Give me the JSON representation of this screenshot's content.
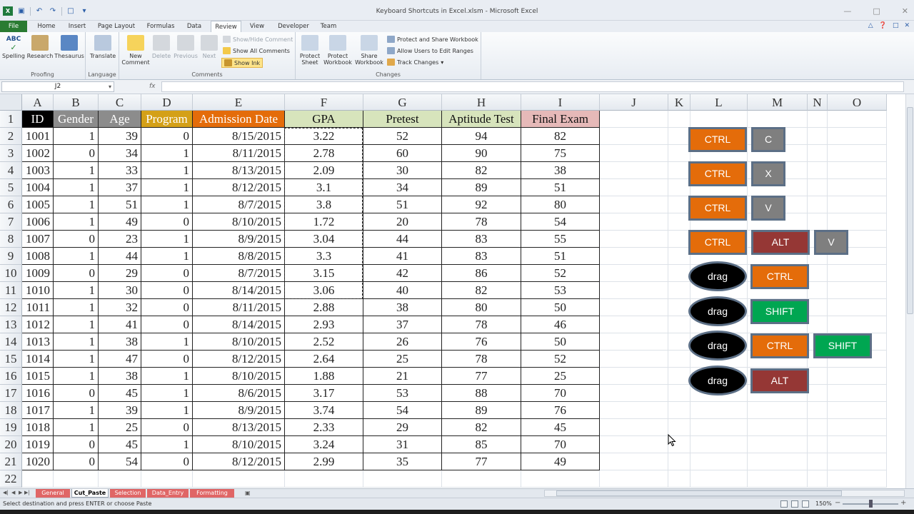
{
  "window": {
    "title": "Keyboard Shortcuts in Excel.xlsm  -  Microsoft Excel"
  },
  "menu_tabs": [
    "File",
    "Home",
    "Insert",
    "Page Layout",
    "Formulas",
    "Data",
    "Review",
    "View",
    "Developer",
    "Team"
  ],
  "active_tab": "Review",
  "ribbon": {
    "groups": {
      "proofing": "Proofing",
      "language": "Language",
      "comments": "Comments",
      "changes": "Changes"
    },
    "buttons": {
      "spelling": "Spelling",
      "research": "Research",
      "thesaurus": "Thesaurus",
      "translate": "Translate",
      "new_comment_1": "New",
      "new_comment_2": "Comment",
      "delete": "Delete",
      "previous": "Previous",
      "next": "Next",
      "show_hide_comment": "Show/Hide Comment",
      "show_all_comments": "Show All Comments",
      "show_ink": "Show Ink",
      "protect_sheet_1": "Protect",
      "protect_sheet_2": "Sheet",
      "protect_workbook_1": "Protect",
      "protect_workbook_2": "Workbook",
      "share_workbook_1": "Share",
      "share_workbook_2": "Workbook",
      "protect_share": "Protect and Share Workbook",
      "allow_users": "Allow Users to Edit Ranges",
      "track_changes": "Track Changes"
    },
    "spelling_glyph": "ABC"
  },
  "formula_bar": {
    "name_box": "J2",
    "fx": "fx",
    "value": ""
  },
  "columns": [
    "A",
    "B",
    "C",
    "D",
    "E",
    "F",
    "G",
    "H",
    "I",
    "J",
    "K",
    "L",
    "M",
    "N",
    "O"
  ],
  "rows": [
    "1",
    "2",
    "3",
    "4",
    "5",
    "6",
    "7",
    "8",
    "9",
    "10",
    "11",
    "12",
    "13",
    "14",
    "15",
    "16",
    "17",
    "18",
    "19",
    "20",
    "21",
    "22"
  ],
  "header_row": [
    "ID",
    "Gender",
    "Age",
    "Program",
    "Admission Date",
    "GPA",
    "Pretest",
    "Aptitude Test",
    "Final Exam"
  ],
  "header_colors": {
    "ID": "#000000",
    "Gender": "#8c8c8c",
    "Age": "#8c8c8c",
    "Program": "#d4a017",
    "Admission Date": "#e46c0a",
    "GPA": "#d7e4bc",
    "Pretest": "#d7e4bc",
    "Aptitude Test": "#d7e4bc",
    "Final Exam": "#e6b9b8"
  },
  "data_rows": [
    [
      "1001",
      "1",
      "39",
      "0",
      "8/15/2015",
      "3.22",
      "52",
      "94",
      "82"
    ],
    [
      "1002",
      "0",
      "34",
      "1",
      "8/11/2015",
      "2.78",
      "60",
      "90",
      "75"
    ],
    [
      "1003",
      "1",
      "33",
      "1",
      "8/13/2015",
      "2.09",
      "30",
      "82",
      "38"
    ],
    [
      "1004",
      "1",
      "37",
      "1",
      "8/12/2015",
      "3.1",
      "34",
      "89",
      "51"
    ],
    [
      "1005",
      "1",
      "51",
      "1",
      "8/7/2015",
      "3.8",
      "51",
      "92",
      "80"
    ],
    [
      "1006",
      "1",
      "49",
      "0",
      "8/10/2015",
      "1.72",
      "20",
      "78",
      "54"
    ],
    [
      "1007",
      "0",
      "23",
      "1",
      "8/9/2015",
      "3.04",
      "44",
      "83",
      "55"
    ],
    [
      "1008",
      "1",
      "44",
      "1",
      "8/8/2015",
      "3.3",
      "41",
      "83",
      "51"
    ],
    [
      "1009",
      "0",
      "29",
      "0",
      "8/7/2015",
      "3.15",
      "42",
      "86",
      "52"
    ],
    [
      "1010",
      "1",
      "30",
      "0",
      "8/14/2015",
      "3.06",
      "40",
      "82",
      "53"
    ],
    [
      "1011",
      "1",
      "32",
      "0",
      "8/11/2015",
      "2.88",
      "38",
      "80",
      "50"
    ],
    [
      "1012",
      "1",
      "41",
      "0",
      "8/14/2015",
      "2.93",
      "37",
      "78",
      "46"
    ],
    [
      "1013",
      "1",
      "38",
      "1",
      "8/10/2015",
      "2.52",
      "26",
      "76",
      "50"
    ],
    [
      "1014",
      "1",
      "47",
      "0",
      "8/12/2015",
      "2.64",
      "25",
      "78",
      "52"
    ],
    [
      "1015",
      "1",
      "38",
      "1",
      "8/10/2015",
      "1.88",
      "21",
      "77",
      "25"
    ],
    [
      "1016",
      "0",
      "45",
      "1",
      "8/6/2015",
      "3.17",
      "53",
      "88",
      "70"
    ],
    [
      "1017",
      "1",
      "39",
      "1",
      "8/9/2015",
      "3.74",
      "54",
      "89",
      "76"
    ],
    [
      "1018",
      "1",
      "25",
      "0",
      "8/13/2015",
      "2.33",
      "29",
      "82",
      "45"
    ],
    [
      "1019",
      "0",
      "45",
      "1",
      "8/10/2015",
      "3.24",
      "31",
      "85",
      "70"
    ],
    [
      "1020",
      "0",
      "54",
      "0",
      "8/12/2015",
      "2.99",
      "35",
      "77",
      "49"
    ]
  ],
  "shortcuts": [
    [
      {
        "label": "CTRL",
        "color": "#e46c0a"
      },
      {
        "label": "C",
        "color": "#7f7f7f"
      }
    ],
    [
      {
        "label": "CTRL",
        "color": "#e46c0a"
      },
      {
        "label": "X",
        "color": "#7f7f7f"
      }
    ],
    [
      {
        "label": "CTRL",
        "color": "#e46c0a"
      },
      {
        "label": "V",
        "color": "#7f7f7f"
      }
    ],
    [
      {
        "label": "CTRL",
        "color": "#e46c0a"
      },
      {
        "label": "ALT",
        "color": "#953735"
      },
      {
        "label": "V",
        "color": "#7f7f7f"
      }
    ],
    [
      {
        "label": "drag",
        "color": "#000000"
      },
      {
        "label": "CTRL",
        "color": "#e46c0a"
      }
    ],
    [
      {
        "label": "drag",
        "color": "#000000"
      },
      {
        "label": "SHIFT",
        "color": "#00a651"
      }
    ],
    [
      {
        "label": "drag",
        "color": "#000000"
      },
      {
        "label": "CTRL",
        "color": "#e46c0a"
      },
      {
        "label": "SHIFT",
        "color": "#00a651"
      }
    ],
    [
      {
        "label": "drag",
        "color": "#000000"
      },
      {
        "label": "ALT",
        "color": "#953735"
      }
    ]
  ],
  "sheet_tabs": [
    {
      "label": "General",
      "color": "#e06666",
      "active": false
    },
    {
      "label": "Cut_Paste",
      "color": "#ffffff",
      "active": true
    },
    {
      "label": "Selection",
      "color": "#e06666",
      "active": false
    },
    {
      "label": "Data_Entry",
      "color": "#e06666",
      "active": false
    },
    {
      "label": "Formatting",
      "color": "#e06666",
      "active": false
    }
  ],
  "status": {
    "message": "Select destination and press ENTER or choose Paste",
    "zoom": "150%",
    "zoom_level": 0.5
  }
}
